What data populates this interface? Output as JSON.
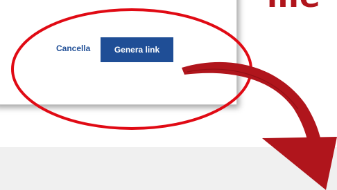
{
  "dialog": {
    "cancel_label": "Cancella",
    "generate_label": "Genera link"
  },
  "annotation": {
    "headline_fragment": "me",
    "color": "#b0151c"
  },
  "colors": {
    "primary": "#1f4e96",
    "background_band": "#f0f0f0"
  }
}
